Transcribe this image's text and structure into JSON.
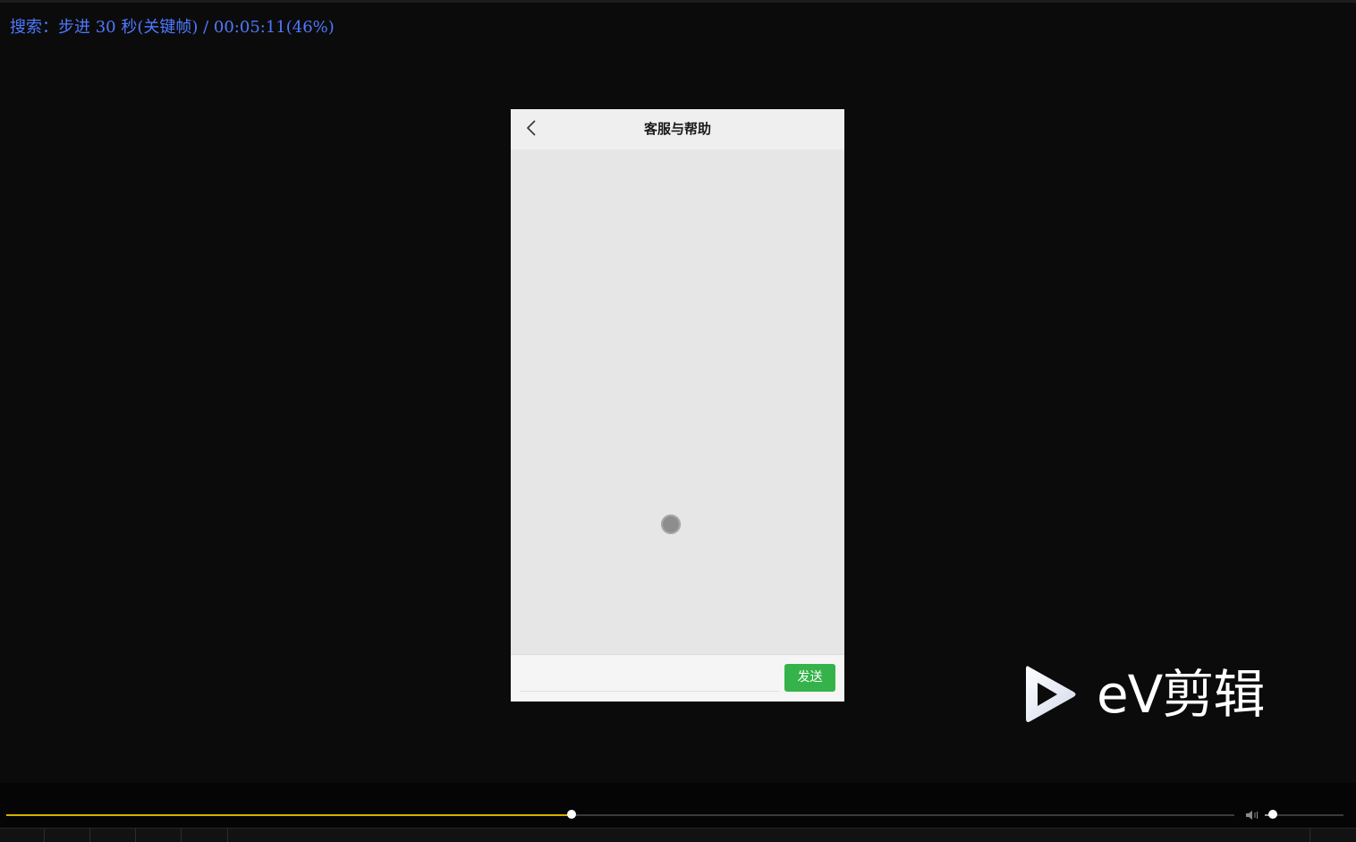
{
  "osd": {
    "text": "搜索：步进 30 秒(关键帧) / 00:05:11(46%)",
    "color": "#4f78ff"
  },
  "phone": {
    "back_icon": "chevron-left-icon",
    "title": "客服与帮助",
    "loading_icon": "loading-spinner-icon",
    "send_label": "发送",
    "send_color": "#35b34a"
  },
  "watermark": {
    "logo_icon": "play-triangle-icon",
    "text": "eV剪辑"
  },
  "player": {
    "progress": 0.46,
    "progress_color": "#d4b000",
    "volume_icon": "speaker-icon",
    "volume": 0.1
  }
}
